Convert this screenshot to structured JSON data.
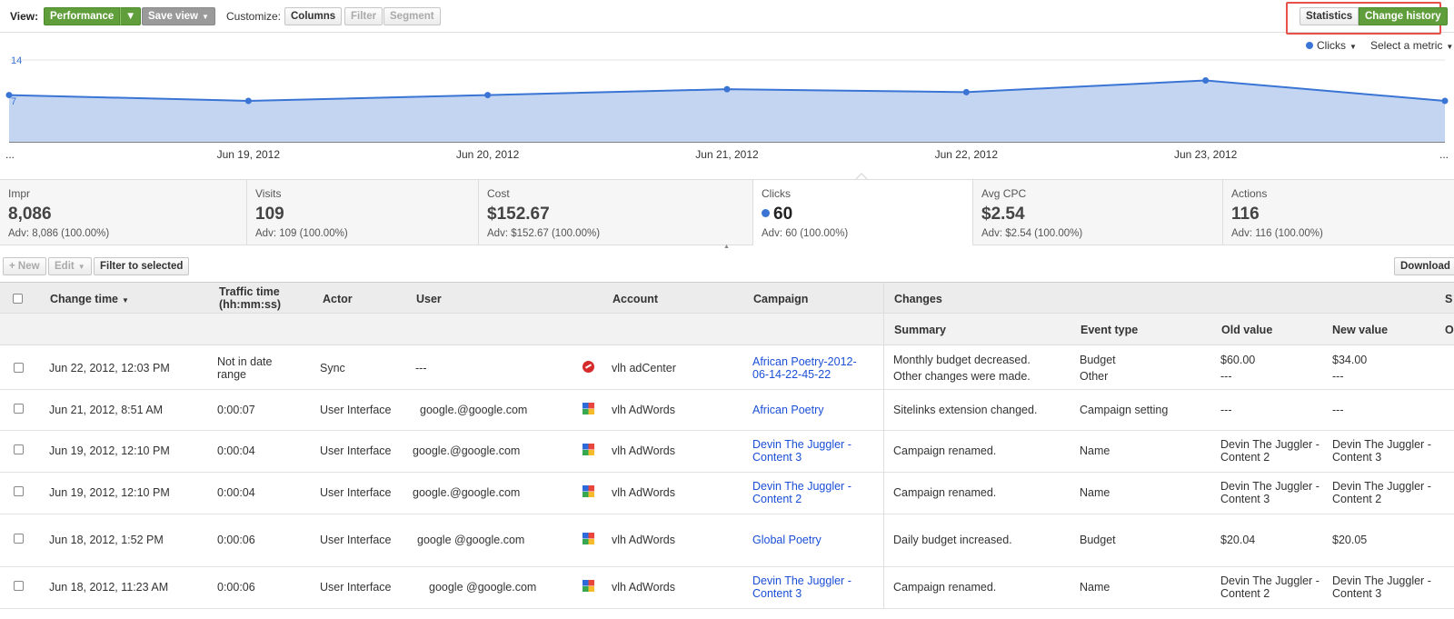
{
  "toolbar": {
    "view_label": "View:",
    "performance": "Performance",
    "save_view": "Save view",
    "customize_label": "Customize:",
    "columns": "Columns",
    "filter": "Filter",
    "segment": "Segment",
    "tab_statistics": "Statistics",
    "tab_change_history": "Change history"
  },
  "chart_controls": {
    "metric": "Clicks",
    "select_metric": "Select a metric"
  },
  "chart_data": {
    "type": "area",
    "x": [
      "...",
      "Jun 19, 2012",
      "Jun 20, 2012",
      "Jun 21, 2012",
      "Jun 22, 2012",
      "Jun 23, 2012",
      "..."
    ],
    "series": [
      {
        "values": [
          8,
          7,
          8,
          9,
          8.5,
          10.5,
          7
        ]
      }
    ],
    "y_ticks": [
      "14",
      "7"
    ],
    "color": "#3a74d4",
    "fill": "#c3d5f0"
  },
  "summary": [
    {
      "label": "Impr",
      "value": "8,086",
      "adv": "Adv: 8,086 (100.00%)"
    },
    {
      "label": "Visits",
      "value": "109",
      "adv": "Adv: 109 (100.00%)"
    },
    {
      "label": "Cost",
      "value": "$152.67",
      "adv": "Adv: $152.67 (100.00%)"
    },
    {
      "label": "Clicks",
      "value": "60",
      "adv": "Adv: 60 (100.00%)"
    },
    {
      "label": "Avg CPC",
      "value": "$2.54",
      "adv": "Adv: $2.54 (100.00%)"
    },
    {
      "label": "Actions",
      "value": "116",
      "adv": "Adv: 116 (100.00%)"
    }
  ],
  "table_toolbar": {
    "new": "+ New",
    "edit": "Edit",
    "filter_selected": "Filter to selected",
    "download": "Download"
  },
  "table": {
    "headers": {
      "change_time": "Change time",
      "traffic_time": "Traffic time (hh:mm:ss)",
      "actor": "Actor",
      "user": "User",
      "account": "Account",
      "campaign": "Campaign",
      "changes": "Changes",
      "summary": "Summary",
      "event_type": "Event type",
      "old_value": "Old value",
      "new_value": "New value",
      "extra": "S",
      "extra2": "O"
    },
    "rows": [
      {
        "time": "Jun 22, 2012, 12:03 PM",
        "traffic": "Not in date range",
        "actor": "Sync",
        "user": "---",
        "icon": "adcenter",
        "account": "vlh adCenter",
        "campaign": "African Poetry-2012-06-14-22-45-22",
        "summary": "Monthly budget decreased.",
        "summary2": "Other changes were made.",
        "event": "Budget",
        "event2": "Other",
        "old": "$60.00",
        "old2": "---",
        "new": "$34.00",
        "new2": "---"
      },
      {
        "time": "Jun 21, 2012, 8:51 AM",
        "traffic": "0:00:07",
        "actor": "User Interface",
        "user": "google.@google.com",
        "icon": "adwords",
        "account": "vlh AdWords",
        "campaign": "African Poetry",
        "summary": "Sitelinks extension changed.",
        "event": "Campaign setting",
        "old": "---",
        "new": "---"
      },
      {
        "time": "Jun 19, 2012, 12:10 PM",
        "traffic": "0:00:04",
        "actor": "User Interface",
        "user": "google.@google.com",
        "icon": "adwords",
        "account": "vlh AdWords",
        "campaign": "Devin The Juggler - Content 3",
        "summary": "Campaign renamed.",
        "event": "Name",
        "old": "Devin The Juggler - Content 2",
        "new": "Devin The Juggler - Content 3"
      },
      {
        "time": "Jun 19, 2012, 12:10 PM",
        "traffic": "0:00:04",
        "actor": "User Interface",
        "user": "google.@google.com",
        "icon": "adwords",
        "account": "vlh AdWords",
        "campaign": "Devin The Juggler - Content 2",
        "summary": "Campaign renamed.",
        "event": "Name",
        "old": "Devin The Juggler - Content 3",
        "new": "Devin The Juggler - Content 2"
      },
      {
        "time": "Jun 18, 2012, 1:52 PM",
        "traffic": "0:00:06",
        "actor": "User Interface",
        "user": "google @google.com",
        "icon": "adwords",
        "account": "vlh AdWords",
        "campaign": "Global Poetry",
        "summary": "Daily budget increased.",
        "event": "Budget",
        "old": "$20.04",
        "new": "$20.05"
      },
      {
        "time": "Jun 18, 2012, 11:23 AM",
        "traffic": "0:00:06",
        "actor": "User Interface",
        "user": "google @google.com",
        "icon": "adwords",
        "account": "vlh AdWords",
        "campaign": "Devin The Juggler - Content 3",
        "summary": "Campaign renamed.",
        "event": "Name",
        "old": "Devin The Juggler - Content 2",
        "new": "Devin The Juggler - Content 3"
      }
    ]
  }
}
